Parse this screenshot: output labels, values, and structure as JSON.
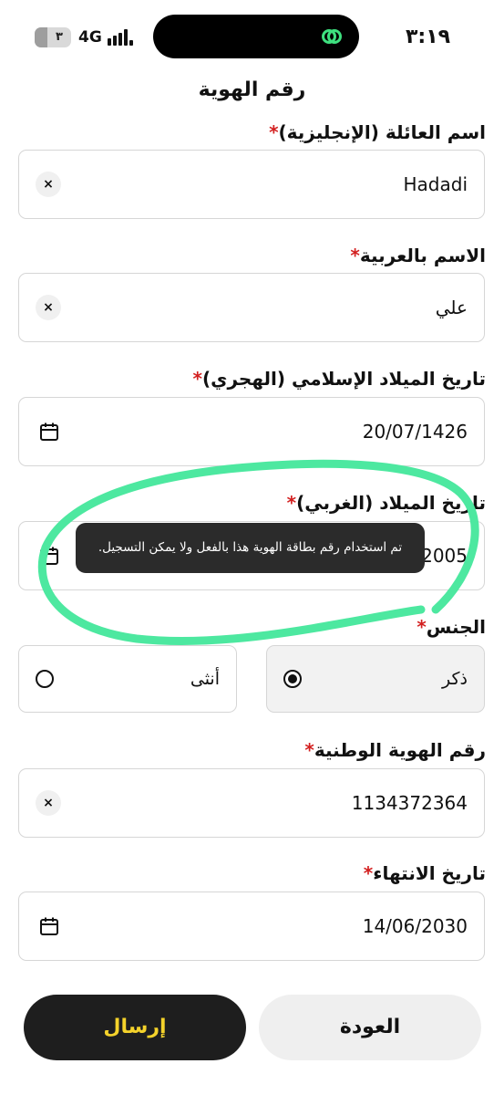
{
  "status_bar": {
    "battery": "٣",
    "network": "4G",
    "time": "٣:١٩"
  },
  "header": {
    "title": "رقم الهوية"
  },
  "form": {
    "required_mark": "*",
    "family_name_en": {
      "label": "اسم العائلة (الإنجليزية)",
      "value": "Hadadi"
    },
    "name_ar": {
      "label": "الاسم بالعربية",
      "value": "علي"
    },
    "hijri_birth": {
      "label": "تاريخ الميلاد الإسلامي (الهجري)",
      "value": "20/07/1426"
    },
    "gregorian_birth": {
      "label": "تاريخ الميلاد (الغربي)",
      "value": "2005"
    },
    "gender": {
      "label": "الجنس",
      "options": [
        "ذكر",
        "أنثى"
      ],
      "selected": "ذكر"
    },
    "national_id": {
      "label": "رقم الهوية الوطنية",
      "value": "1134372364"
    },
    "expiry": {
      "label": "تاريخ الانتهاء",
      "value": "14/06/2030"
    }
  },
  "tooltip": {
    "message": "تم استخدام رقم بطاقة الهوية هذا بالفعل ولا يمكن التسجيل."
  },
  "buttons": {
    "back": "العودة",
    "submit": "إرسال"
  },
  "icons": {
    "clear": "clear-icon",
    "calendar": "calendar-icon",
    "radio": "radio-icon"
  },
  "colors": {
    "required": "#d32020",
    "submit_text": "#f4d22b",
    "submit_bg": "#1e1e1e",
    "annotation": "#4de8a0",
    "tooltip_bg": "#2b2b2b"
  }
}
